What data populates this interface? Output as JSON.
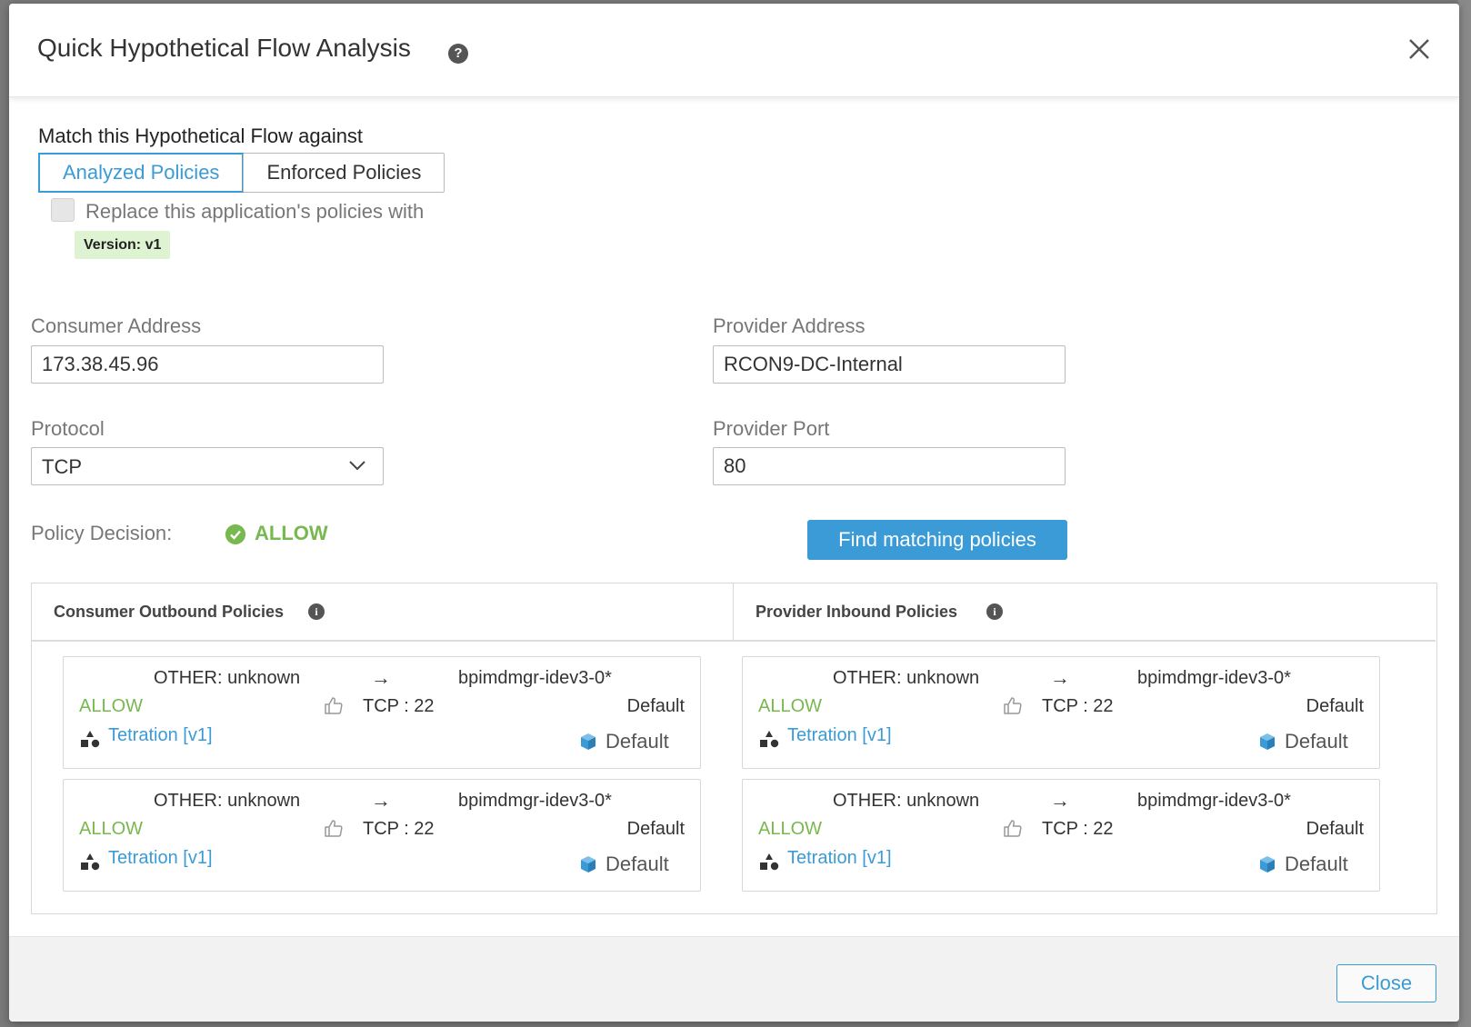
{
  "dialog": {
    "title": "Quick Hypothetical Flow Analysis",
    "help_icon": "question-circle-icon",
    "close_icon": "close-x-icon"
  },
  "match": {
    "label": "Match this Hypothetical Flow against",
    "options": [
      "Analyzed Policies",
      "Enforced Policies"
    ],
    "selected": "Analyzed Policies"
  },
  "replace": {
    "checked": false,
    "label": "Replace this application's policies with",
    "version_badge": "Version: v1"
  },
  "form": {
    "consumer_address_label": "Consumer Address",
    "consumer_address_value": "173.38.45.96",
    "provider_address_label": "Provider Address",
    "provider_address_value": "RCON9-DC-Internal",
    "protocol_label": "Protocol",
    "protocol_value": "TCP",
    "provider_port_label": "Provider Port",
    "provider_port_value": "80"
  },
  "decision": {
    "label": "Policy Decision:",
    "value": "ALLOW",
    "color": "#77b94e"
  },
  "find_button": "Find matching policies",
  "policies": {
    "consumer_title": "Consumer Outbound Policies",
    "provider_title": "Provider Inbound Policies",
    "consumer": [
      {
        "src": "OTHER: unknown",
        "arrow": "→",
        "dst": "bpimdmgr-idev3-0*",
        "action": "ALLOW",
        "proto": "TCP : 22",
        "scope": "Default",
        "workspace": "Tetration [v1]",
        "cube_label": "Default"
      },
      {
        "src": "OTHER: unknown",
        "arrow": "→",
        "dst": "bpimdmgr-idev3-0*",
        "action": "ALLOW",
        "proto": "TCP : 22",
        "scope": "Default",
        "workspace": "Tetration [v1]",
        "cube_label": "Default"
      }
    ],
    "provider": [
      {
        "src": "OTHER: unknown",
        "arrow": "→",
        "dst": "bpimdmgr-idev3-0*",
        "action": "ALLOW",
        "proto": "TCP : 22",
        "scope": "Default",
        "workspace": "Tetration [v1]",
        "cube_label": "Default"
      },
      {
        "src": "OTHER: unknown",
        "arrow": "→",
        "dst": "bpimdmgr-idev3-0*",
        "action": "ALLOW",
        "proto": "TCP : 22",
        "scope": "Default",
        "workspace": "Tetration [v1]",
        "cube_label": "Default"
      }
    ]
  },
  "footer": {
    "close_label": "Close"
  },
  "colors": {
    "accent": "#3b9bd6",
    "allow": "#77b94e",
    "badge_bg": "#def3d2"
  }
}
